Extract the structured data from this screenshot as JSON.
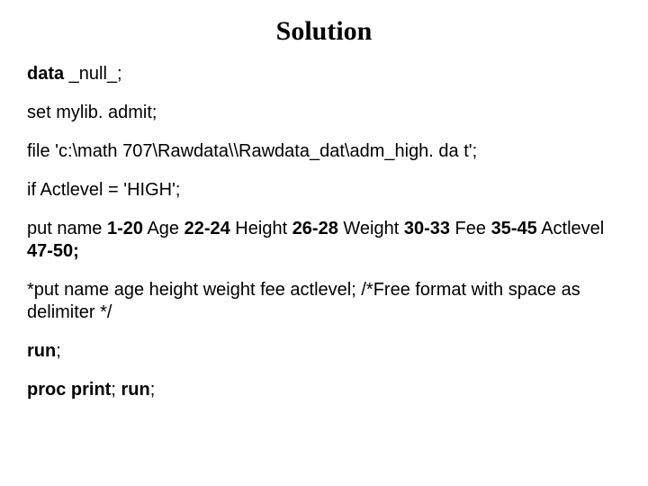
{
  "title": "Solution",
  "lines": {
    "l1_kw": "data",
    "l1_rest": " _null_;",
    "l2": "set mylib. admit;",
    "l3": "file 'c:\\math 707\\Rawdata\\\\Rawdata_dat\\adm_high. da t';",
    "l4": "if Actlevel = 'HIGH';",
    "l5_p1": "put name ",
    "l5_b1": "1-20",
    "l5_p2": " Age ",
    "l5_b2": "22-24",
    "l5_p3": " Height ",
    "l5_b3": "26-28",
    "l5_p4": " Weight ",
    "l5_b4": "30-33",
    "l5_p5": " Fee ",
    "l5_b5": "35-45",
    "l5_p6": "  Actlevel ",
    "l5_b6": "47-50;",
    "l6": "*put name age height weight fee actlevel; /*Free format with space as delimiter */",
    "l7_kw": "run",
    "l7_rest": ";",
    "l8_kw1": "proc print",
    "l8_mid": "; ",
    "l8_kw2": "run",
    "l8_end": ";"
  }
}
